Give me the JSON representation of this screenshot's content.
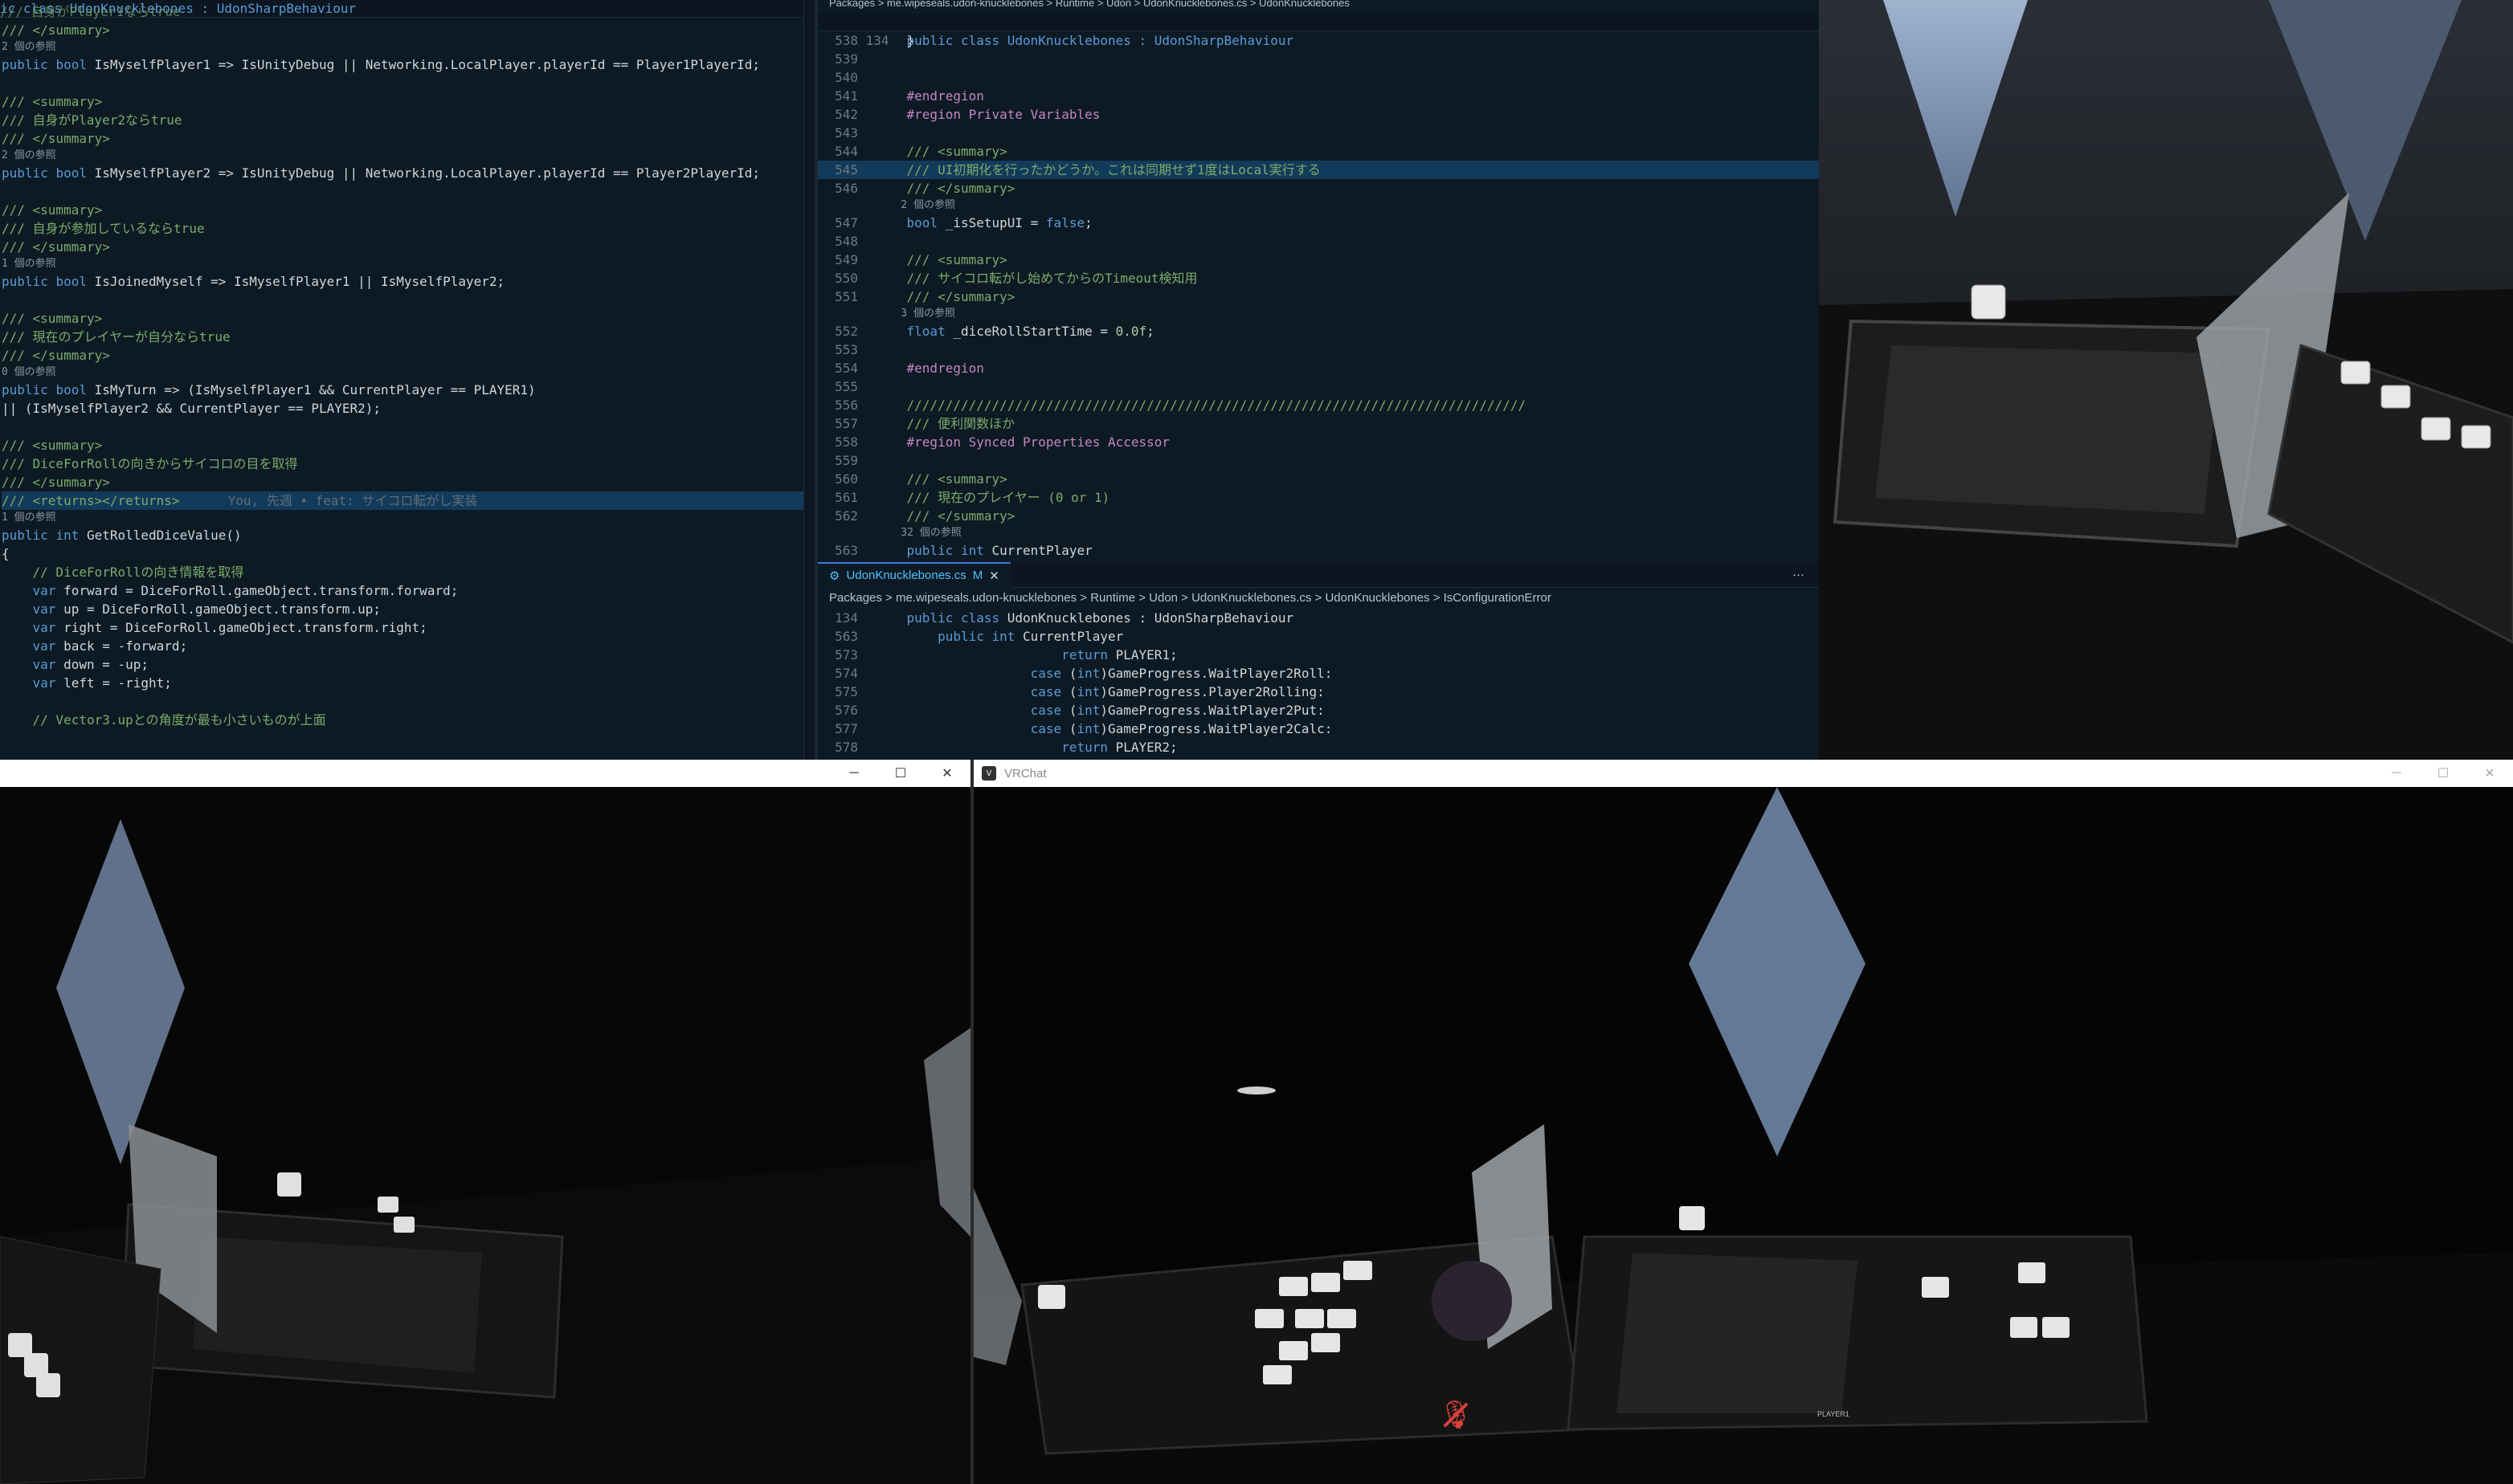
{
  "left_editor": {
    "header_partial": "ic class UdonKnucklebones : UdonSharpBehaviour",
    "top_clipped": "/// 自身がPlayer1ならtrue",
    "lines": [
      {
        "k": "text",
        "t": "/// </summary>"
      },
      {
        "k": "lens",
        "t": "2 個の参照"
      },
      {
        "k": "text",
        "t": "public bool IsMyselfPlayer1 => IsUnityDebug || Networking.LocalPlayer.playerId == Player1PlayerId;"
      },
      {
        "k": "text",
        "t": ""
      },
      {
        "k": "text",
        "t": "/// <summary>"
      },
      {
        "k": "text",
        "t": "/// 自身がPlayer2ならtrue"
      },
      {
        "k": "text",
        "t": "/// </summary>"
      },
      {
        "k": "lens",
        "t": "2 個の参照"
      },
      {
        "k": "text",
        "t": "public bool IsMyselfPlayer2 => IsUnityDebug || Networking.LocalPlayer.playerId == Player2PlayerId;"
      },
      {
        "k": "text",
        "t": ""
      },
      {
        "k": "text",
        "t": "/// <summary>"
      },
      {
        "k": "text",
        "t": "/// 自身が参加しているならtrue"
      },
      {
        "k": "text",
        "t": "/// </summary>"
      },
      {
        "k": "lens",
        "t": "1 個の参照"
      },
      {
        "k": "text",
        "t": "public bool IsJoinedMyself => IsMyselfPlayer1 || IsMyselfPlayer2;"
      },
      {
        "k": "text",
        "t": ""
      },
      {
        "k": "text",
        "t": "/// <summary>"
      },
      {
        "k": "text",
        "t": "/// 現在のプレイヤーが自分ならtrue"
      },
      {
        "k": "text",
        "t": "/// </summary>"
      },
      {
        "k": "lens",
        "t": "0 個の参照"
      },
      {
        "k": "text",
        "t": "public bool IsMyTurn => (IsMyselfPlayer1 && CurrentPlayer == PLAYER1)"
      },
      {
        "k": "text",
        "t": "|| (IsMyselfPlayer2 && CurrentPlayer == PLAYER2);"
      },
      {
        "k": "text",
        "t": ""
      },
      {
        "k": "text",
        "t": "/// <summary>"
      },
      {
        "k": "text",
        "t": "/// DiceForRollの向きからサイコロの目を取得"
      },
      {
        "k": "text",
        "t": "/// </summary>"
      },
      {
        "k": "hl",
        "t": "/// <returns></returns>"
      },
      {
        "k": "lens",
        "t": "1 個の参照"
      },
      {
        "k": "text",
        "t": "public int GetRolledDiceValue()"
      },
      {
        "k": "text",
        "t": "{"
      },
      {
        "k": "text",
        "t": "    // DiceForRollの向き情報を取得"
      },
      {
        "k": "text",
        "t": "    var forward = DiceForRoll.gameObject.transform.forward;"
      },
      {
        "k": "text",
        "t": "    var up = DiceForRoll.gameObject.transform.up;"
      },
      {
        "k": "text",
        "t": "    var right = DiceForRoll.gameObject.transform.right;"
      },
      {
        "k": "text",
        "t": "    var back = -forward;"
      },
      {
        "k": "text",
        "t": "    var down = -up;"
      },
      {
        "k": "text",
        "t": "    var left = -right;"
      },
      {
        "k": "text",
        "t": ""
      },
      {
        "k": "text",
        "t": "    // Vector3.upとの角度が最も小さいものが上面"
      }
    ],
    "blame": "You, 先週 • feat: サイコロ転がし実装"
  },
  "right_editor_top": {
    "breadcrumb": "Packages > me.wipeseals.udon-knucklebones > Runtime > Udon > UdonKnucklebones.cs > UdonKnucklebones",
    "sticky_ln": "134",
    "sticky": "public class UdonKnucklebones : UdonSharpBehaviour",
    "lines": [
      {
        "ln": "538",
        "t": "    }"
      },
      {
        "ln": "539",
        "t": ""
      },
      {
        "ln": "540",
        "t": ""
      },
      {
        "ln": "541",
        "t": "    #endregion"
      },
      {
        "ln": "542",
        "t": "    #region Private Variables"
      },
      {
        "ln": "543",
        "t": ""
      },
      {
        "ln": "544",
        "t": "    /// <summary>"
      },
      {
        "ln": "545",
        "t": "    /// UI初期化を行ったかどうか。これは同期せず1度はLocal実行する",
        "hl": true
      },
      {
        "ln": "546",
        "t": "    /// </summary>"
      },
      {
        "ln": "",
        "t": "    2 個の参照",
        "lens": true
      },
      {
        "ln": "547",
        "t": "    bool _isSetupUI = false;"
      },
      {
        "ln": "548",
        "t": ""
      },
      {
        "ln": "549",
        "t": "    /// <summary>"
      },
      {
        "ln": "550",
        "t": "    /// サイコロ転がし始めてからのTimeout検知用"
      },
      {
        "ln": "551",
        "t": "    /// </summary>"
      },
      {
        "ln": "",
        "t": "    3 個の参照",
        "lens": true
      },
      {
        "ln": "552",
        "t": "    float _diceRollStartTime = 0.0f;"
      },
      {
        "ln": "553",
        "t": ""
      },
      {
        "ln": "554",
        "t": "    #endregion"
      },
      {
        "ln": "555",
        "t": ""
      },
      {
        "ln": "556",
        "t": "    ////////////////////////////////////////////////////////////////////////////////"
      },
      {
        "ln": "557",
        "t": "    /// 便利関数ほか"
      },
      {
        "ln": "558",
        "t": "    #region Synced Properties Accessor"
      },
      {
        "ln": "559",
        "t": ""
      },
      {
        "ln": "560",
        "t": "    /// <summary>"
      },
      {
        "ln": "561",
        "t": "    /// 現在のプレイヤー (0 or 1)"
      },
      {
        "ln": "562",
        "t": "    /// </summary>"
      },
      {
        "ln": "",
        "t": "    32 個の参照",
        "lens": true
      },
      {
        "ln": "563",
        "t": "    public int CurrentPlayer"
      }
    ]
  },
  "right_editor_bottom": {
    "tab_label": "UdonKnucklebones.cs",
    "tab_badge": "M",
    "more": "···",
    "breadcrumb": [
      "Packages",
      "me.wipeseals.udon-knucklebones",
      "Runtime",
      "Udon",
      "UdonKnucklebones.cs",
      "UdonKnucklebones",
      "IsConfigurationError"
    ],
    "lines": [
      {
        "ln": "134",
        "t": "    public class UdonKnucklebones : UdonSharpBehaviour"
      },
      {
        "ln": "563",
        "t": "        public int CurrentPlayer"
      },
      {
        "ln": "573",
        "t": "                        return PLAYER1;"
      },
      {
        "ln": "574",
        "t": "                    case (int)GameProgress.WaitPlayer2Roll:"
      },
      {
        "ln": "575",
        "t": "                    case (int)GameProgress.Player2Rolling:"
      },
      {
        "ln": "576",
        "t": "                    case (int)GameProgress.WaitPlayer2Put:"
      },
      {
        "ln": "577",
        "t": "                    case (int)GameProgress.WaitPlayer2Calc:"
      },
      {
        "ln": "578",
        "t": "                        return PLAYER2;"
      }
    ]
  },
  "left_window": {
    "minimize": "─",
    "maximize": "☐",
    "close": "✕"
  },
  "vrchat_window": {
    "title": "VRChat",
    "minimize": "─",
    "maximize": "☐",
    "close": "✕"
  },
  "scene": {
    "player_label": "PLAYER1"
  },
  "colors": {
    "accent": "#3b7bd6",
    "editor_bg": "#0d1a24",
    "mute_red": "#d9413a"
  }
}
